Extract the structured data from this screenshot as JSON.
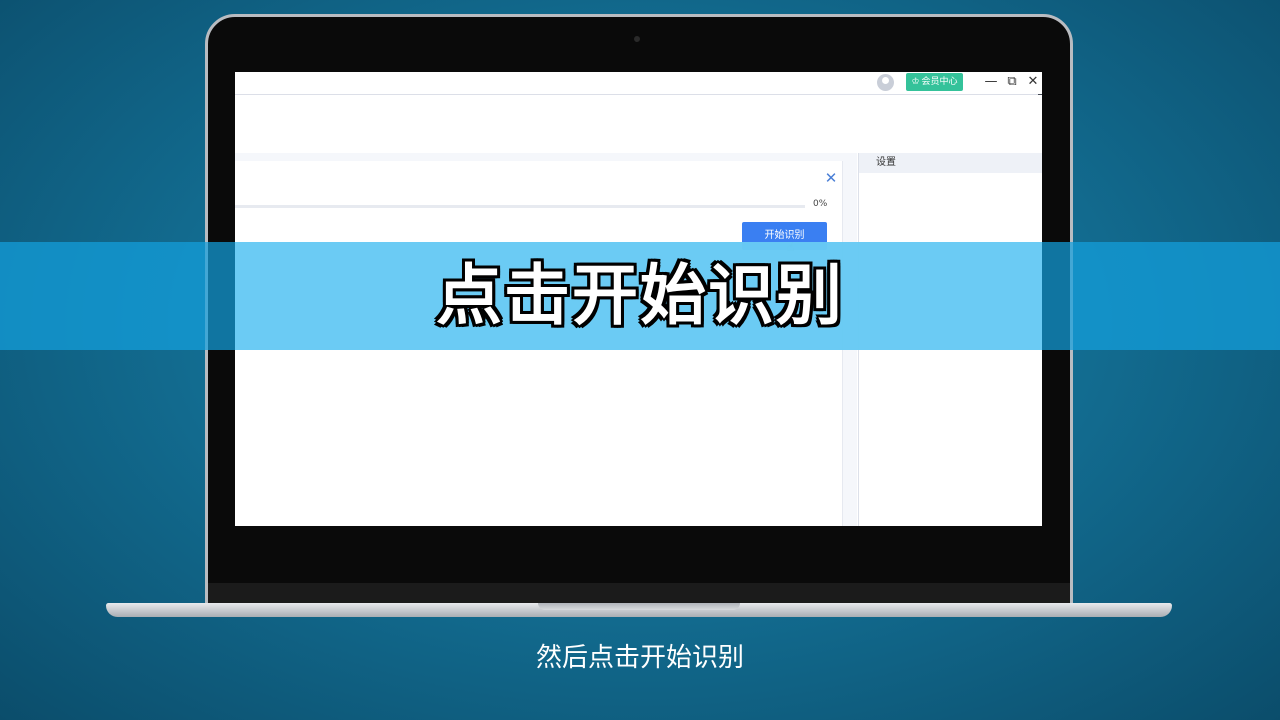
{
  "window": {
    "member_center_label": "会员中心",
    "minimize_symbol": "—",
    "restore_symbol": "⧉",
    "close_symbol": "✕"
  },
  "dialog": {
    "close_symbol": "✕",
    "progress_percent": 0,
    "progress_label": "0%",
    "start_button_label": "开始识别"
  },
  "side_panel": {
    "title": "设置"
  },
  "overlay": {
    "banner_text": "点击开始识别",
    "subtitle": "然后点击开始识别"
  },
  "colors": {
    "accent": "#3a7ff2",
    "member_badge": "#34c29a",
    "banner": "#6ecdf5",
    "background": "#136f94"
  },
  "icons": {
    "avatar": "user-avatar-icon",
    "member_badge": "crown-icon",
    "cursor": "hand-pointer-icon"
  }
}
